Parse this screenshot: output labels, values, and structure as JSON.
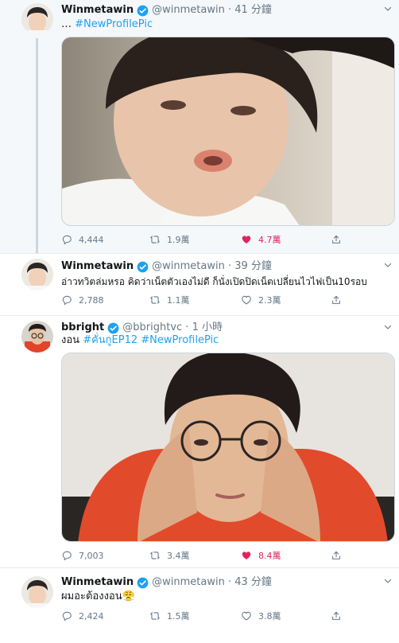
{
  "tweets": [
    {
      "name": "Winmetawin",
      "handle": "@winmetawin",
      "time": "41 分鐘",
      "text_prefix": "… ",
      "hashtag": "#NewProfilePic",
      "replies": "4,444",
      "retweets": "1.9萬",
      "likes": "4.7萬",
      "liked": true
    },
    {
      "name": "Winmetawin",
      "handle": "@winmetawin",
      "time": "39 分鐘",
      "text": "อ่าวทวิตล่มหรอ คิดว่าเน็ตตัวเองไม่ดี ก็นั่งเปิดปิดเน็ตเปลี่ยนไวไฟเป็น10รอบ",
      "replies": "2,788",
      "retweets": "1.1萬",
      "likes": "2.3萬",
      "liked": false
    },
    {
      "name": "bbright",
      "handle": "@bbrightvc",
      "time": "1 小時",
      "text_prefix": "งอน ",
      "hashtag": "#คั่นกูEP12",
      "hashtag2": "#NewProfilePic",
      "replies": "7,003",
      "retweets": "3.4萬",
      "likes": "8.4萬",
      "liked": true
    },
    {
      "name": "Winmetawin",
      "handle": "@winmetawin",
      "time": "43 分鐘",
      "text": "ผมอะต้องงอน😤",
      "replies": "2,424",
      "retweets": "1.5萬",
      "likes": "3.8萬",
      "liked": false
    }
  ],
  "colors": {
    "accent": "#1da1f2",
    "like": "#e0245e",
    "meta": "#657786",
    "highlight_bg": "#f5f8fa"
  },
  "icons": [
    "verified-badge-icon",
    "chevron-down-icon",
    "reply-icon",
    "retweet-icon",
    "heart-icon",
    "share-icon"
  ]
}
